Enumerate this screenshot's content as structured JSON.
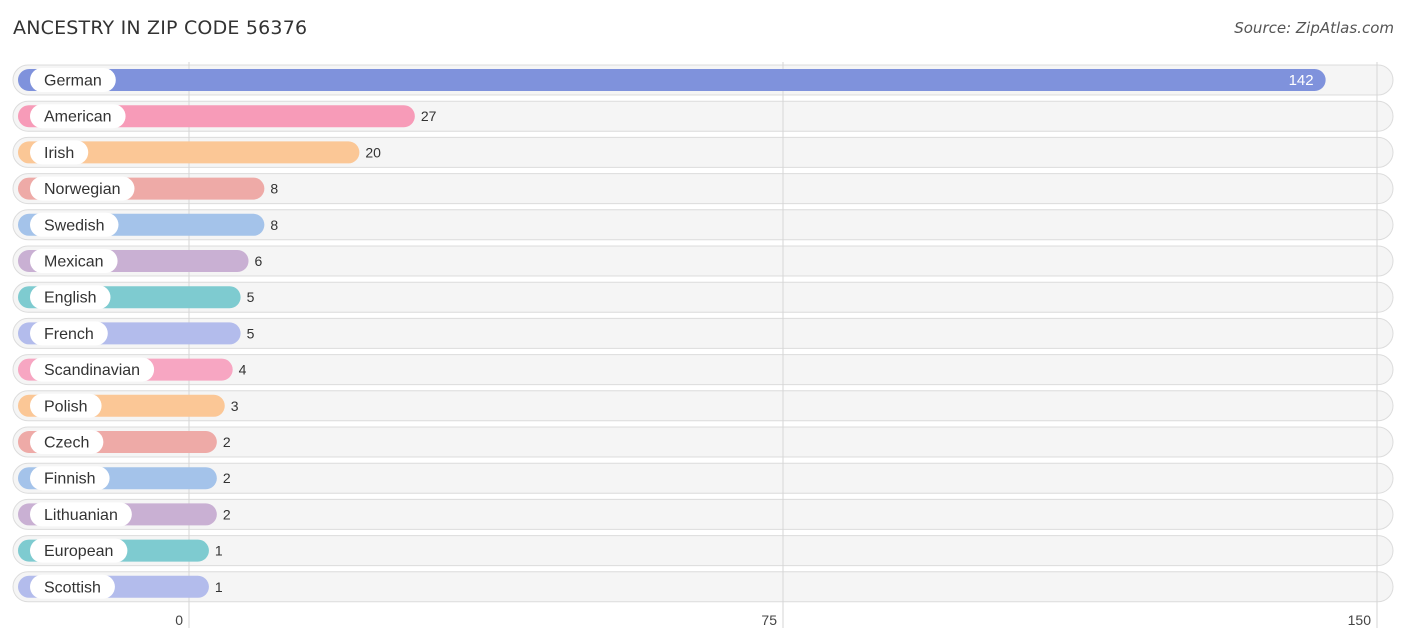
{
  "header": {
    "title": "ANCESTRY IN ZIP CODE 56376",
    "source": "Source: ZipAtlas.com"
  },
  "chart_data": {
    "type": "bar",
    "orientation": "horizontal",
    "title": "ANCESTRY IN ZIP CODE 56376",
    "xlabel": "",
    "ylabel": "",
    "xlim": [
      0,
      150
    ],
    "x_ticks": [
      0,
      75,
      150
    ],
    "x_tick_labels": [
      "0",
      "75",
      "150"
    ],
    "grid": true,
    "categories": [
      "German",
      "American",
      "Irish",
      "Norwegian",
      "Swedish",
      "Mexican",
      "English",
      "French",
      "Scandinavian",
      "Polish",
      "Czech",
      "Finnish",
      "Lithuanian",
      "European",
      "Scottish"
    ],
    "values": [
      142,
      27,
      20,
      8,
      8,
      6,
      5,
      5,
      4,
      3,
      2,
      2,
      2,
      1,
      1
    ],
    "colors": [
      "#7f92dc",
      "#f79bb8",
      "#fbc796",
      "#eeaaa7",
      "#a4c3ea",
      "#c9b0d3",
      "#7ecbd0",
      "#b3bcec",
      "#f7a6c2",
      "#fbc796",
      "#eeaaa7",
      "#a4c3ea",
      "#c9b0d3",
      "#7ecbd0",
      "#b3bcec"
    ]
  }
}
